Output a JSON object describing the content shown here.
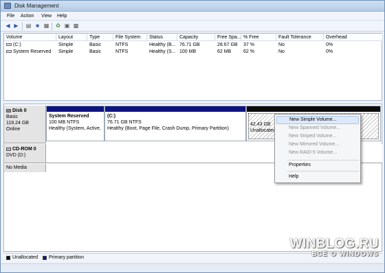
{
  "window": {
    "title": "Disk Management"
  },
  "menu": [
    "File",
    "Action",
    "View",
    "Help"
  ],
  "toolbar": [
    "back-icon",
    "forward-icon",
    "list-view-icon",
    "help-icon",
    "properties-icon",
    "refresh-icon",
    "rescan-icon",
    "settings-icon"
  ],
  "table": {
    "columns": [
      "Volume",
      "Layout",
      "Type",
      "File System",
      "Status",
      "Capacity",
      "Free Spa...",
      "% Free",
      "Fault Tolerance",
      "Overhead"
    ],
    "rows": [
      [
        "(C:)",
        "Simple",
        "Basic",
        "NTFS",
        "Healthy (B...",
        "76.71 GB",
        "28.67 GB",
        "37 %",
        "No",
        "0%"
      ],
      [
        "System Reserved",
        "Simple",
        "Basic",
        "NTFS",
        "Healthy (S...",
        "100 MB",
        "62 MB",
        "62 %",
        "No",
        "0%"
      ]
    ]
  },
  "disk0": {
    "name": "Disk 0",
    "type": "Basic",
    "size": "119.24 GB",
    "state": "Online",
    "partitions": [
      {
        "name": "System Reserved",
        "size": "100 MB NTFS",
        "status": "Healthy (System, Active,"
      },
      {
        "name": "(C:)",
        "size": "76.71 GB NTFS",
        "status": "Healthy (Boot, Page File, Crash Dump, Primary Partition)"
      },
      {
        "name": "",
        "size": "42.43 GB",
        "status": "Unallocated"
      }
    ]
  },
  "cdrom": {
    "name": "CD-ROM 0",
    "drive": "DVD (D:)",
    "media": "No Media"
  },
  "context_menu": {
    "items": [
      {
        "label": "New Simple Volume...",
        "enabled": true
      },
      {
        "label": "New Spanned Volume...",
        "enabled": false
      },
      {
        "label": "New Striped Volume...",
        "enabled": false
      },
      {
        "label": "New Mirrored Volume...",
        "enabled": false
      },
      {
        "label": "New RAID-5 Volume...",
        "enabled": false
      },
      {
        "label": "Properties",
        "enabled": true
      },
      {
        "label": "Help",
        "enabled": true
      }
    ]
  },
  "legend": {
    "unallocated": "Unallocated",
    "primary": "Primary partition",
    "unallocated_color": "#000000",
    "primary_color": "#0d1481"
  },
  "watermark": {
    "main": "WINBLOG.RU",
    "sub": "ВСЁ О WINDOWS"
  }
}
